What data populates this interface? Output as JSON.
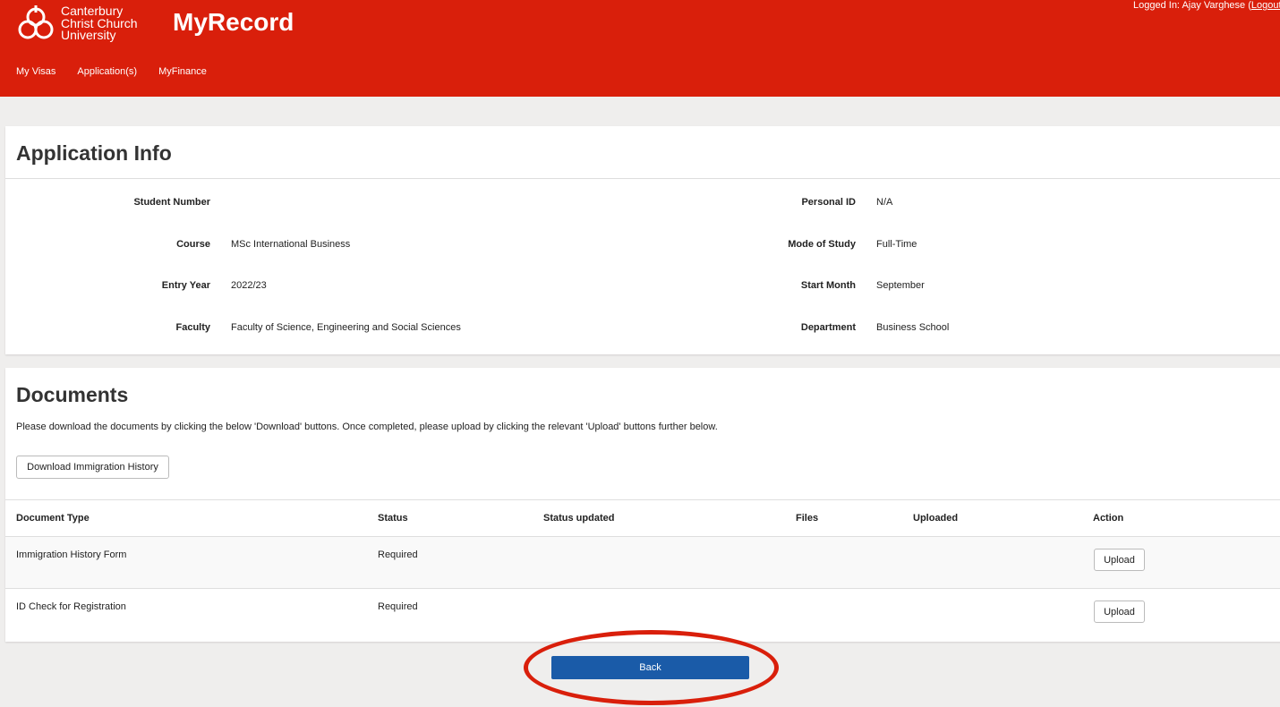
{
  "header": {
    "logo_lines": [
      "Canterbury",
      "Christ Church",
      "University"
    ],
    "app_title": "MyRecord",
    "logged_in_prefix": "Logged In: Ajay Varghese (",
    "logout_label": "Logout",
    "nav": [
      "My Visas",
      "Application(s)",
      "MyFinance"
    ]
  },
  "application_info": {
    "title": "Application Info",
    "fields_left": [
      {
        "label": "Student Number",
        "value": ""
      },
      {
        "label": "Course",
        "value": "MSc International Business"
      },
      {
        "label": "Entry Year",
        "value": "2022/23"
      },
      {
        "label": "Faculty",
        "value": "Faculty of Science, Engineering and Social Sciences"
      }
    ],
    "fields_right": [
      {
        "label": "Personal ID",
        "value": "N/A"
      },
      {
        "label": "Mode of Study",
        "value": "Full-Time"
      },
      {
        "label": "Start Month",
        "value": "September"
      },
      {
        "label": "Department",
        "value": "Business School"
      }
    ]
  },
  "documents": {
    "title": "Documents",
    "intro": "Please download the documents by clicking the below 'Download' buttons. Once completed, please upload by clicking the relevant 'Upload' buttons further below.",
    "download_button": "Download Immigration History",
    "columns": [
      "Document Type",
      "Status",
      "Status updated",
      "Files",
      "Uploaded",
      "Action"
    ],
    "rows": [
      {
        "type": "Immigration History Form",
        "status": "Required",
        "action": "Upload"
      },
      {
        "type": "ID Check for Registration",
        "status": "Required",
        "action": "Upload"
      }
    ]
  },
  "back_button": "Back",
  "colors": {
    "brand_red": "#d91f0b",
    "button_blue": "#1a5ba8"
  }
}
